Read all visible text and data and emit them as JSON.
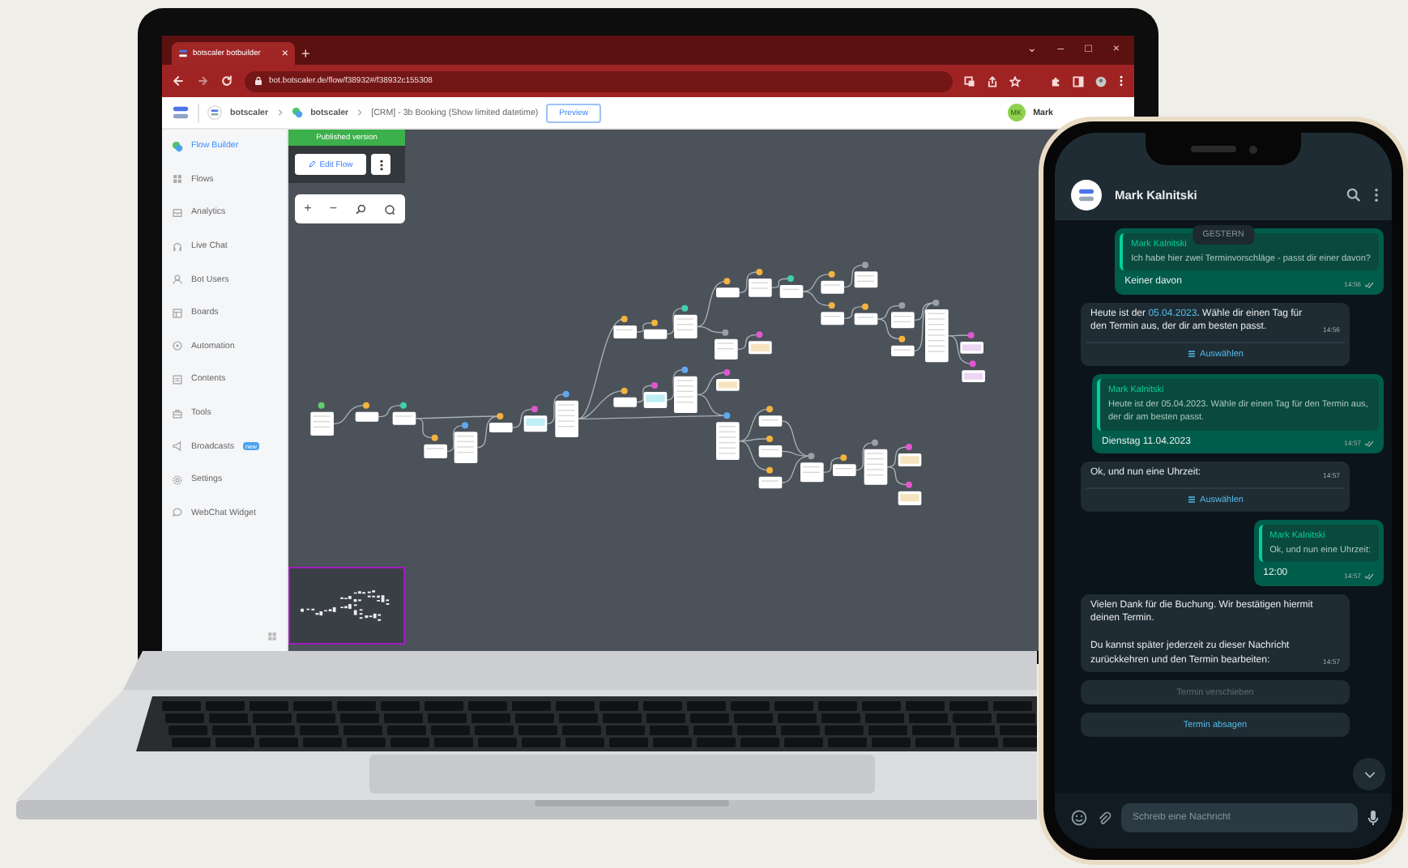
{
  "browser": {
    "tab_title": "botscaler botbuilder",
    "tab_close": "×",
    "new_tab": "+",
    "window_controls": [
      "⌄",
      "–",
      "□",
      "×"
    ],
    "url": "bot.botscaler.de/flow/f38932#/f38932c155308"
  },
  "app_header": {
    "breadcrumbs": [
      "botscaler",
      "botscaler",
      "[CRM] - 3b Booking (Show limited datetime)"
    ],
    "preview_button": "Preview",
    "avatar_initials": "MK",
    "user_name": "Mark"
  },
  "sidebar": {
    "items": [
      {
        "label": "Flow Builder",
        "selected": true
      },
      {
        "label": "Flows",
        "selected": false
      },
      {
        "label": "Analytics",
        "selected": false
      },
      {
        "label": "Live Chat",
        "selected": false
      },
      {
        "label": "Bot Users",
        "selected": false
      },
      {
        "label": "Boards",
        "selected": false
      },
      {
        "label": "Automation",
        "selected": false
      },
      {
        "label": "Contents",
        "selected": false
      },
      {
        "label": "Tools",
        "selected": false
      },
      {
        "label": "Broadcasts",
        "selected": false,
        "badge": "new"
      },
      {
        "label": "Settings",
        "selected": false
      },
      {
        "label": "WebChat Widget",
        "selected": false
      }
    ]
  },
  "flow_editor": {
    "status_banner": "Published version",
    "edit_button": "Edit Flow",
    "zoom_in": "+",
    "zoom_out": "−"
  },
  "phone_chat": {
    "contact_name": "Mark Kalnitski",
    "date_chip": "GESTERN",
    "messages": [
      {
        "kind": "quoted_reply",
        "author": "Mark Kalnitski",
        "quote": "Ich habe hier zwei Terminvorschläge - passt dir einer davon?",
        "text": "Keiner davon",
        "time": "14:56"
      },
      {
        "kind": "incoming",
        "text": "Heute ist der ",
        "link": "05.04.2023",
        "text_after": ". Wähle dir einen Tag für den Termin aus, der dir am besten passt.",
        "time": "14:56",
        "action": "Auswählen"
      },
      {
        "kind": "quoted_reply",
        "author": "Mark Kalnitski",
        "quote": "Heute ist der 05.04.2023. Wähle dir einen Tag für den Termin aus, der dir am besten passt.",
        "text": "Dienstag 11.04.2023",
        "time": "14:57"
      },
      {
        "kind": "incoming",
        "text": "Ok, und nun eine Uhrzeit:",
        "time": "14:57",
        "action": "Auswählen"
      },
      {
        "kind": "quoted_reply",
        "author": "Mark Kalnitski",
        "quote": "Ok, und nun eine Uhrzeit:",
        "text": "12:00",
        "time": "14:57"
      },
      {
        "kind": "incoming",
        "text": "Vielen Dank für die Buchung. Wir bestätigen hiermit deinen Termin.\n\nDu kannst später jederzeit zu dieser Nachricht zurückkehren und den Termin bearbeiten:",
        "time": "14:57"
      }
    ],
    "reply_buttons": [
      {
        "label": "Termin verschieben",
        "disabled": true
      },
      {
        "label": "Termin absagen",
        "disabled": false
      }
    ],
    "input_placeholder": "Schreib eine Nachricht"
  }
}
